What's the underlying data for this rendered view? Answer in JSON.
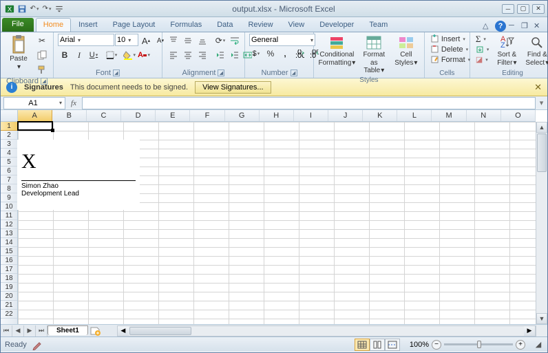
{
  "title": "output.xlsx - Microsoft Excel",
  "tabs": {
    "file": "File",
    "home": "Home",
    "insert": "Insert",
    "page_layout": "Page Layout",
    "formulas": "Formulas",
    "data": "Data",
    "review": "Review",
    "view": "View",
    "developer": "Developer",
    "team": "Team"
  },
  "groups": {
    "clipboard": "Clipboard",
    "font": "Font",
    "alignment": "Alignment",
    "number": "Number",
    "styles": "Styles",
    "cells": "Cells",
    "editing": "Editing"
  },
  "clipboard": {
    "paste": "Paste"
  },
  "font": {
    "family": "Arial",
    "size": "10",
    "bold": "B",
    "italic": "I",
    "underline": "U",
    "increase": "A",
    "decrease": "A"
  },
  "number": {
    "format": "General",
    "currency": "$",
    "percent": "%",
    "comma": ","
  },
  "styles": {
    "conditional_l1": "Conditional",
    "conditional_l2": "Formatting",
    "table_l1": "Format",
    "table_l2": "as Table",
    "cell_l1": "Cell",
    "cell_l2": "Styles"
  },
  "cells": {
    "insert": "Insert",
    "delete": "Delete",
    "format": "Format"
  },
  "editing": {
    "sort_l1": "Sort &",
    "sort_l2": "Filter",
    "find_l1": "Find &",
    "find_l2": "Select"
  },
  "msgbar": {
    "title": "Signatures",
    "text": "This document needs to be signed.",
    "button": "View Signatures..."
  },
  "namebox": "A1",
  "columns": [
    "A",
    "B",
    "C",
    "D",
    "E",
    "F",
    "G",
    "H",
    "I",
    "J",
    "K",
    "L",
    "M",
    "N",
    "O"
  ],
  "rowcount": 22,
  "signature": {
    "x": "X",
    "name": "Simon Zhao",
    "role": "Development Lead"
  },
  "sheets": {
    "sheet1": "Sheet1"
  },
  "status": {
    "ready": "Ready",
    "zoom": "100%"
  },
  "glyph": {
    "scissors": "✂",
    "sigma": "Σ",
    "eraser": "◪"
  }
}
